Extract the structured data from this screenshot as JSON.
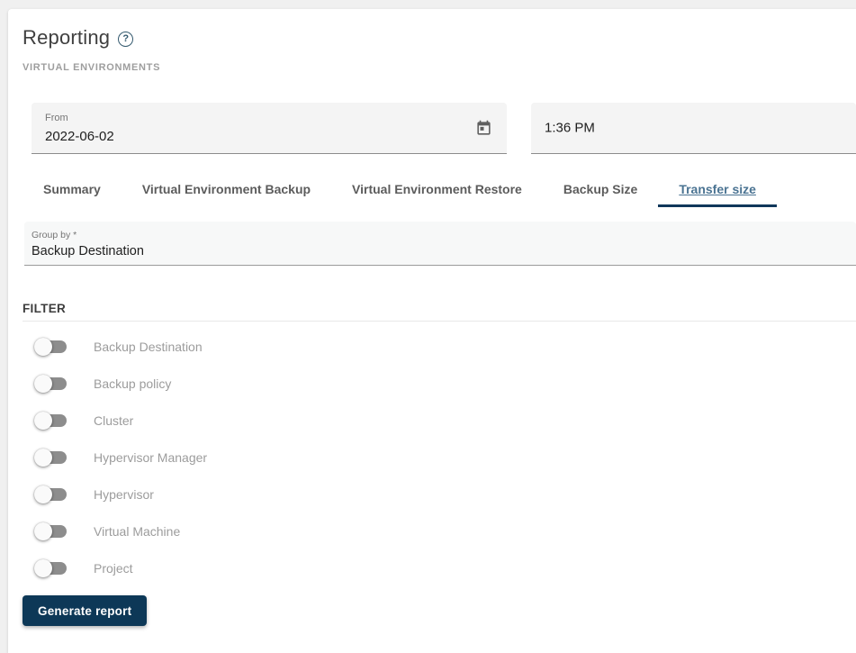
{
  "page": {
    "title": "Reporting",
    "section_label": "VIRTUAL ENVIRONMENTS"
  },
  "icons": {
    "help_glyph": "?"
  },
  "date_filter": {
    "from_label": "From",
    "from_value": "2022-06-02",
    "time_value": "1:36 PM"
  },
  "tabs": [
    {
      "label": "Summary",
      "active": false
    },
    {
      "label": "Virtual Environment Backup",
      "active": false
    },
    {
      "label": "Virtual Environment Restore",
      "active": false
    },
    {
      "label": "Backup Size",
      "active": false
    },
    {
      "label": "Transfer size",
      "active": true
    }
  ],
  "group_by": {
    "label": "Group by *",
    "value": "Backup Destination"
  },
  "filter": {
    "heading": "FILTER",
    "toggles": [
      {
        "label": "Backup Destination",
        "on": false
      },
      {
        "label": "Backup policy",
        "on": false
      },
      {
        "label": "Cluster",
        "on": false
      },
      {
        "label": "Hypervisor Manager",
        "on": false
      },
      {
        "label": "Hypervisor",
        "on": false
      },
      {
        "label": "Virtual Machine",
        "on": false
      },
      {
        "label": "Project",
        "on": false
      }
    ]
  },
  "actions": {
    "generate_label": "Generate report"
  },
  "colors": {
    "accent_navy": "#0d3857",
    "active_tab_text": "#4a7392",
    "inactive_tab_text": "#5c5c5c",
    "toggle_track": "#8d8d8d",
    "muted_label": "#9c9c9c",
    "page_background": "#f0f0f0",
    "card_background": "#ffffff"
  }
}
